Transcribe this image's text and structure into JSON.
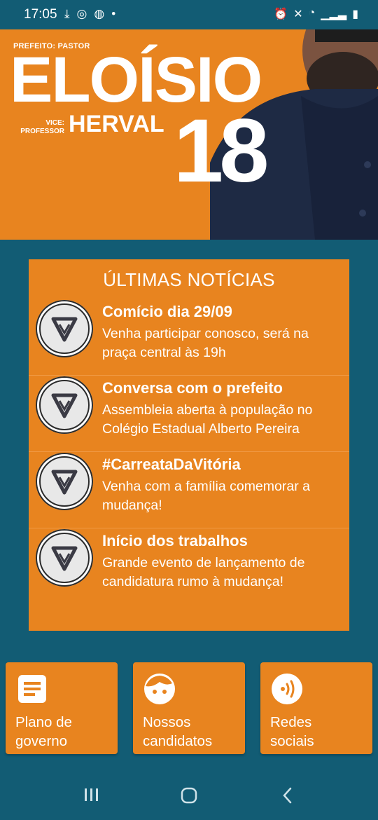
{
  "status_bar": {
    "time": "17:05"
  },
  "banner": {
    "prefeito_label": "PREFEITO: PASTOR",
    "name": "ELOÍSIO",
    "vice_label_line1": "VICE:",
    "vice_label_line2": "PROFESSOR",
    "vice_name": "HERVAL",
    "number": "18"
  },
  "news": {
    "title": "ÚLTIMAS NOTÍCIAS",
    "items": [
      {
        "headline": "Comício dia 29/09",
        "description": "Venha participar conosco, será na praça central às 19h"
      },
      {
        "headline": "Conversa com o prefeito",
        "description": "Assembleia aberta à população no Colégio Estadual Alberto Pereira"
      },
      {
        "headline": "#CarreataDaVitória",
        "description": "Venha com a família comemorar a mudança!"
      },
      {
        "headline": "Início dos trabalhos",
        "description": "Grande evento de lançamento de candidatura rumo à mudança!"
      }
    ]
  },
  "cards": [
    {
      "label_line1": "Plano de",
      "label_line2": "governo",
      "icon": "document-icon"
    },
    {
      "label_line1": "Nossos",
      "label_line2": "candidatos",
      "icon": "face-icon"
    },
    {
      "label_line1": "Redes",
      "label_line2": "sociais",
      "icon": "broadcast-icon"
    }
  ],
  "colors": {
    "background": "#125c74",
    "accent_orange": "#e8841f"
  }
}
